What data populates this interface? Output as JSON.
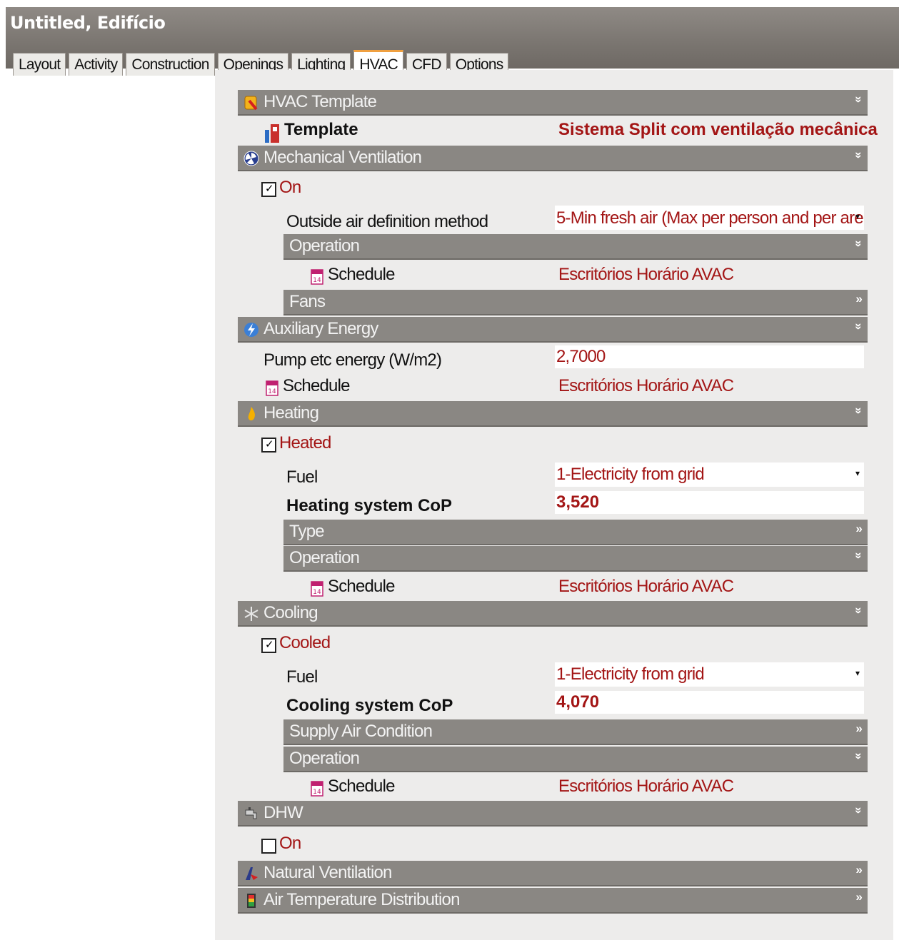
{
  "window": {
    "title": "Untitled, Edifício"
  },
  "tabs": [
    "Layout",
    "Activity",
    "Construction",
    "Openings",
    "Lighting",
    "HVAC",
    "CFD",
    "Options"
  ],
  "active_tab": "HVAC",
  "hvac_template": {
    "header": "HVAC Template",
    "template_label": "Template",
    "template_value": "Sistema Split com ventilação mecânica"
  },
  "mechanical_ventilation": {
    "header": "Mechanical Ventilation",
    "on_label": "On",
    "on_checked": true,
    "outside_air_label": "Outside air definition method",
    "outside_air_value": "5-Min fresh air (Max per person and per are",
    "operation_header": "Operation",
    "schedule_label": "Schedule",
    "schedule_value": "Escritórios Horário AVAC",
    "fans_header": "Fans"
  },
  "auxiliary_energy": {
    "header": "Auxiliary Energy",
    "pump_label": "Pump etc energy (W/m2)",
    "pump_value": "2,7000",
    "schedule_label": "Schedule",
    "schedule_value": "Escritórios Horário AVAC"
  },
  "heating": {
    "header": "Heating",
    "heated_label": "Heated",
    "heated_checked": true,
    "fuel_label": "Fuel",
    "fuel_value": "1-Electricity from grid",
    "cop_label": "Heating system CoP",
    "cop_value": "3,520",
    "type_header": "Type",
    "operation_header": "Operation",
    "schedule_label": "Schedule",
    "schedule_value": "Escritórios Horário AVAC"
  },
  "cooling": {
    "header": "Cooling",
    "cooled_label": "Cooled",
    "cooled_checked": true,
    "fuel_label": "Fuel",
    "fuel_value": "1-Electricity from grid",
    "cop_label": "Cooling system CoP",
    "cop_value": "4,070",
    "supply_header": "Supply Air Condition",
    "operation_header": "Operation",
    "schedule_label": "Schedule",
    "schedule_value": "Escritórios Horário AVAC"
  },
  "dhw": {
    "header": "DHW",
    "on_label": "On",
    "on_checked": false
  },
  "natural_ventilation": {
    "header": "Natural Ventilation"
  },
  "air_temperature_distribution": {
    "header": "Air Temperature Distribution"
  },
  "symbols": {
    "expanded": "»",
    "collapsed": "»",
    "dropdown": "▾",
    "check": "✓"
  },
  "colors": {
    "header_bar": "#8a8783",
    "value_red": "#a31515",
    "active_tab_accent": "#f0a040"
  }
}
